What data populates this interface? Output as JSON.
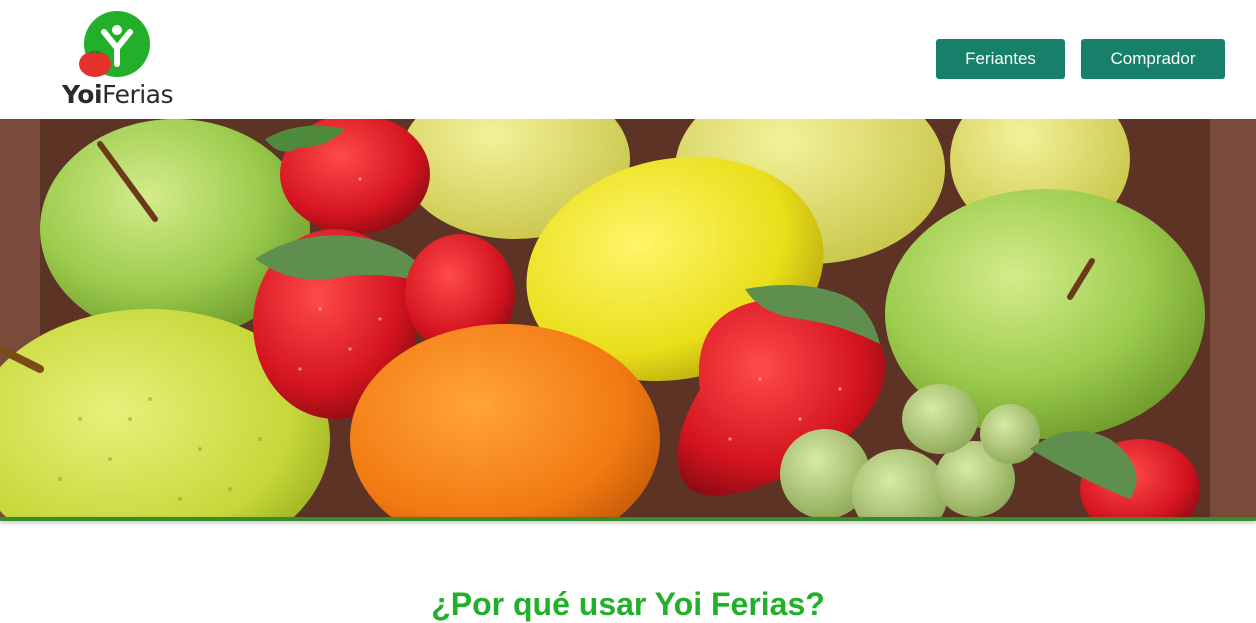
{
  "header": {
    "logo": {
      "text_part1": "Yoi",
      "text_part2": "Ferias",
      "brand_green": "#22b02a",
      "tomato_red": "#e5322d"
    },
    "nav": {
      "feriantes_label": "Feriantes",
      "comprador_label": "Comprador",
      "button_color": "#17806a"
    }
  },
  "hero": {
    "image_subject": "fruit-crate-photo",
    "accent_bar_color": "#3a8a2e"
  },
  "main": {
    "section_title": "¿Por qué usar Yoi Ferias?"
  }
}
